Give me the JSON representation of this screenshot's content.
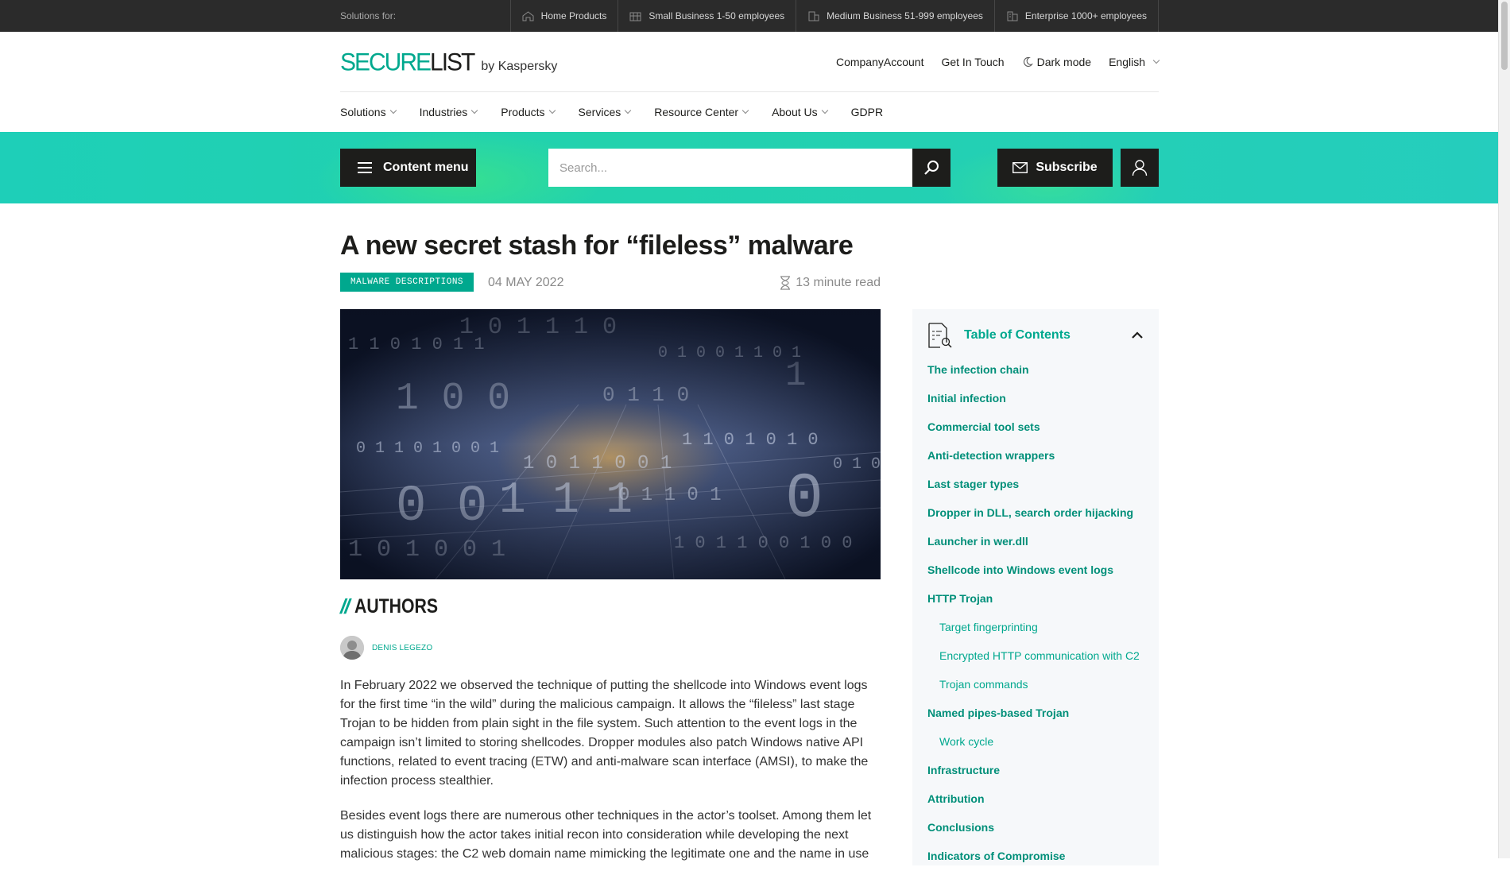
{
  "topbar": {
    "solutions_label": "Solutions for:",
    "segments": [
      {
        "label": "Home Products",
        "icon": "home-icon"
      },
      {
        "label": "Small Business 1-50 employees",
        "icon": "small-business-icon"
      },
      {
        "label": "Medium Business 51-999 employees",
        "icon": "medium-business-icon"
      },
      {
        "label": "Enterprise 1000+ employees",
        "icon": "enterprise-icon"
      }
    ]
  },
  "header": {
    "logo_secure": "SECURE",
    "logo_list": "LIST",
    "logo_by": "by Kaspersky",
    "links": {
      "company_account": "CompanyAccount",
      "get_in_touch": "Get In Touch",
      "dark_mode": "Dark mode",
      "language": "English"
    }
  },
  "nav": {
    "items": [
      "Solutions",
      "Industries",
      "Products",
      "Services",
      "Resource Center",
      "About Us",
      "GDPR"
    ]
  },
  "band": {
    "content_menu_label": "Content menu",
    "search_placeholder": "Search...",
    "subscribe_label": "Subscribe"
  },
  "article": {
    "title": "A new secret stash for “fileless” malware",
    "category": "MALWARE DESCRIPTIONS",
    "date": "04 MAY 2022",
    "read_time": "13 minute read",
    "authors_label": "AUTHORS",
    "authors_slashes": "//",
    "author_name": "DENIS LEGEZO",
    "paragraphs": [
      "In February 2022 we observed the technique of putting the shellcode into Windows event logs for the first time “in the wild” during the malicious campaign. It allows the “fileless” last stage Trojan to be hidden from plain sight in the file system. Such attention to the event logs in the campaign isn’t limited to storing shellcodes. Dropper modules also patch Windows native API functions, related to event tracing (ETW) and anti-malware scan interface (AMSI), to make the infection process stealthier.",
      "Besides event logs there are numerous other techniques in the actor’s toolset. Among them let us distinguish how the actor takes initial recon into consideration while developing the next malicious stages: the C2 web domain name mimicking the legitimate one and the name in use"
    ]
  },
  "toc": {
    "title": "Table of Contents",
    "items": [
      {
        "label": "The infection chain",
        "sub": false
      },
      {
        "label": "Initial infection",
        "sub": false
      },
      {
        "label": "Commercial tool sets",
        "sub": false
      },
      {
        "label": "Anti-detection wrappers",
        "sub": false
      },
      {
        "label": "Last stager types",
        "sub": false
      },
      {
        "label": "Dropper in DLL, search order hijacking",
        "sub": false
      },
      {
        "label": "Launcher in wer.dll",
        "sub": false
      },
      {
        "label": "Shellcode into Windows event logs",
        "sub": false
      },
      {
        "label": "HTTP Trojan",
        "sub": false
      },
      {
        "label": "Target fingerprinting",
        "sub": true
      },
      {
        "label": "Encrypted HTTP communication with C2",
        "sub": true
      },
      {
        "label": "Trojan commands",
        "sub": true
      },
      {
        "label": "Named pipes-based Trojan",
        "sub": false
      },
      {
        "label": "Work cycle",
        "sub": true
      },
      {
        "label": "Infrastructure",
        "sub": false
      },
      {
        "label": "Attribution",
        "sub": false
      },
      {
        "label": "Conclusions",
        "sub": false
      },
      {
        "label": "Indicators of Compromise",
        "sub": false
      }
    ]
  },
  "colors": {
    "accent": "#00a88e",
    "band": "#22d2ad",
    "dark": "#1d1d1b",
    "topbar": "#2b2b2b"
  }
}
